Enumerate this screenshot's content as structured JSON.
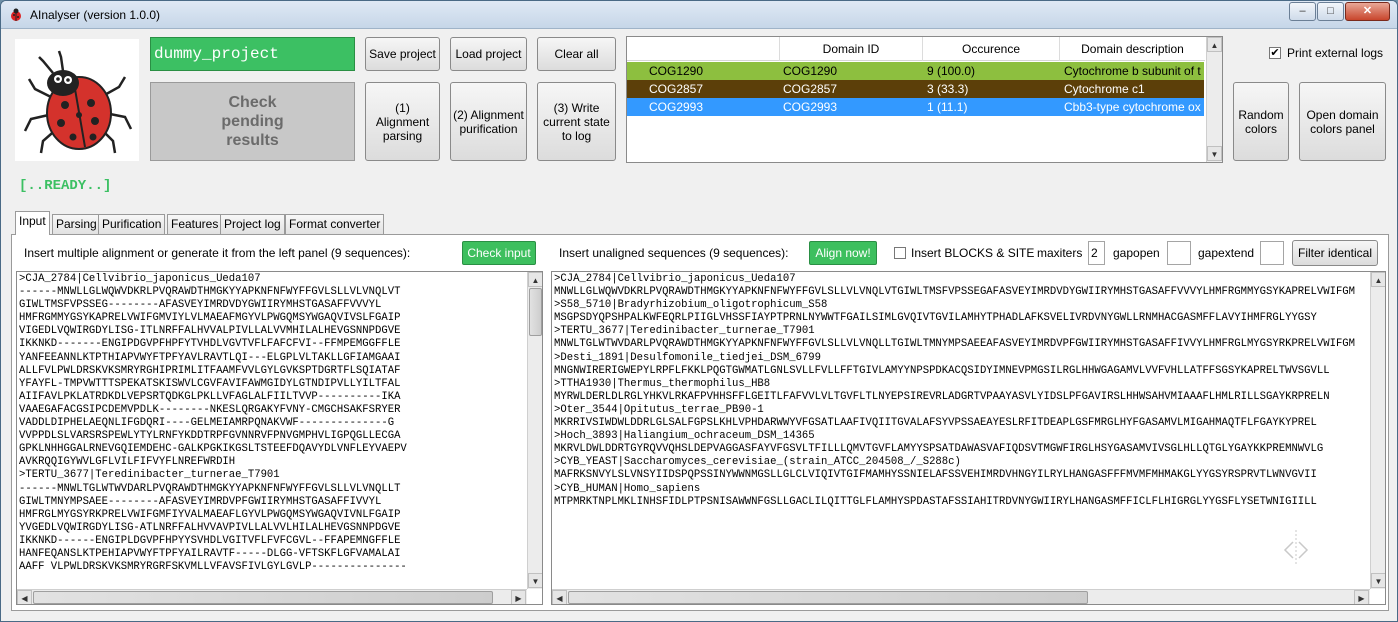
{
  "window": {
    "title": "AInalyser (version 1.0.0)",
    "min_glyph": "–",
    "max_glyph": "□",
    "close_glyph": "✕"
  },
  "project": {
    "name": "dummy_project",
    "check_label": "Check pending results",
    "status": "[..READY..]"
  },
  "toolbar": {
    "save": "Save project",
    "load": "Load project",
    "clear": "Clear all",
    "step1": "(1) Alignment parsing",
    "step2": "(2) Alignment purification",
    "step3": "(3) Write current state to log"
  },
  "domains": {
    "headers": [
      "",
      "Domain ID",
      "Occurence",
      "Domain description"
    ],
    "rows": [
      {
        "name": "COG1290",
        "id": "COG1290",
        "occ": "9 (100.0)",
        "desc": "Cytochrome b subunit of t",
        "bg": "#8dbf3f",
        "fg": "#000000"
      },
      {
        "name": "COG2857",
        "id": "COG2857",
        "occ": "3 (33.3)",
        "desc": "Cytochrome c1",
        "bg": "#5c3f09",
        "fg": "#ffffff"
      },
      {
        "name": "COG2993",
        "id": "COG2993",
        "occ": "1 (11.1)",
        "desc": "Cbb3-type cytochrome ox",
        "bg": "#3399ff",
        "fg": "#ffffff"
      }
    ]
  },
  "right": {
    "print_logs": "Print external logs",
    "print_logs_checked": true,
    "random_colors": "Random colors",
    "open_panel": "Open domain colors panel"
  },
  "tabs": [
    "Input",
    "Parsing",
    "Purification",
    "Features",
    "Project log",
    "Format converter"
  ],
  "left_pane": {
    "prompt": "Insert multiple alignment or generate it from the left panel (9 sequences):",
    "check_input": "Check input",
    "text": ">CJA_2784|Cellvibrio_japonicus_Ueda107\n------MNWLLGLWQWVDKRLPVQRAWDTHMGKYYAPKNFNFWYFFGVLSLLVLVNQLVT\nGIWLTMSFVPSSEG--------AFASVEYIMRDVDYGWIIRYMHSTGASAFFVVVYL\nHMFRGMMYGSYKAPRELVWIFGMVIYLVLMAEAFMGYVLPWGQMSYWGAQVIVSLFGAIP\nVIGEDLVQWIRGDYLISG-ITLNRFFALHVVALPIVLLALVVMHILALHEVGSNNPDGVE\nIKKNKD-------ENGIPDGVPFHPFYTVHDLVGVTVFLFAFCFVI--FFMPEMGGFFLE\nYANFEEANNLKTPTHIAPVWYFTPFYAVLRAVTLQI---ELGPLVLTAKLLGFIAMGAAI\nALLFVLPWLDRSKVKSMRYRGHIPRIMLITFAAMFVVLGYLGVKSPTDGRTFLSQIATAF\nYFAYFL-TMPVWTTTSPEKATSKISWVLCGVFAVIFAWMGIDYLGTNDIPVLLYILTFAL\nAIIFAVLPKLATRDKDLVEPSRTQDKGLPKLLVFAGLALFIILTVVP----------IKA\nVAAEGAFACGSIPCDEMVPDLK--------NKESLQRGAKYFVNY-CMGCHSAKFSRYER\nVADDLDIPHELAEQNLIFGDQRI----GELMEIAMRPQNAKVWF--------------G\nVVPPDLSLVARSRSPEWLYTYLRNFYKDDTRPFGVNNRVFPNVGMPHVLIGPQGLLECGA\nGPKLNHHGGALRNEVGQIEMDEHC-GALKPGKIKGSLTSTEEFDQAVYDLVNFLEYVAEPV\nAVKRQQIGYWVLGFLVILFIFVYFLNREFWRDIH\n>TERTU_3677|Teredinibacter_turnerae_T7901\n------MNWLTGLWTWVDARLPVQRAWDTHMGKYYAPKNFNFWYFFGVLSLLVLVNQLLT\nGIWLTMNYMPSAEE--------AFASVEYIMRDVPFGWIIRYMHSTGASAFFIVVYL\nHMFRGLMYGSYRKPRELVWIFGMFIYVALMAEAFLGYVLPWGQMSYWGAQVIVNLFGAIP\nYVGEDLVQWIRGDYLISG-ATLNRFFALHVVAVPIVLLALVVLHILALHEVGSNNPDGVE\nIKKNKD------ENGIPLDGVPFHPYYSVHDLVGITVFLFVFCGVL--FFAPEMNGFFLE\nHANFEQANSLKTPEHIAPVWYFTPFYAILRAVTF-----DLGG-VFTSKFLGFVAMALAI\nAAFF VLPWLDRSKVKSMRYRGRFSKVMLLVFAVSFIVLGYLGVLP---------------"
  },
  "right_pane": {
    "prompt": "Insert unaligned sequences (9 sequences):",
    "align_now": "Align now!",
    "blocks_label": "Insert BLOCKS & SITE",
    "blocks_checked": false,
    "maxiters_label": "maxiters",
    "maxiters_value": "2",
    "gapopen_label": "gapopen",
    "gapopen_value": "",
    "gapextend_label": "gapextend",
    "gapextend_value": "",
    "filter": "Filter identical",
    "text": ">CJA_2784|Cellvibrio_japonicus_Ueda107\nMNWLLGLWQWVDKRLPVQRAWDTHMGKYYAPKNFNFWYFFGVLSLLVLVNQLVTGIWLTMSFVPSSEGAFASVEYIMRDVDYGWIIRYMHSTGASAFFVVVYLHMFRGMMYGSYKAPRELVWIFGM\n>S58_5710|Bradyrhizobium_oligotrophicum_S58\nMSGPSDYQPSHPALKWFEQRLPIIGLVHSSFIAYPTPRNLNYWWTFGAILSIMLGVQIVTGVILAMHYTPHADLAFKSVELIVRDVNYGWLLRNMHACGASMFFLAVYIHMFRGLYYGSY\n>TERTU_3677|Teredinibacter_turnerae_T7901\nMNWLTGLWTWVDARLPVQRAWDTHMGKYYAPKNFNFWYFFGVLSLLVLVNQLLTGIWLTMNYMPSAEEAFASVEYIMRDVPFGWIIRYMHSTGASAFFIVVYLHMFRGLMYGSYRKPRELVWIFGM\n>Desti_1891|Desulfomonile_tiedjei_DSM_6799\nMNGNWIRERIGWEPYLRPFLFKKLPQGTGWMATLGNLSVLLFVLLFFTGIVLAMYYNPSPDKACQSIDYIMNEVPMGSILRGLHHWGAGAMVLVVFVHLLATFFSGSYKAPRELTWVSGVLL\n>TTHA1930|Thermus_thermophilus_HB8\nMYRWLDERLDLRGLYHKVLRKAFPVHHSFFLGEITLFAFVVLVLTGVFLTLNYEPSIREVRLADGRTVPAAYASVLYIDSLPFGAVIRSLHHWSAHVMIAAAFLHMLRILLSGAYKRPRELN\n>Oter_3544|Opitutus_terrae_PB90-1\nMKRRIVSIWDWLDDRLGLSALFGPSLKHLVPHDARWWYVFGSATLAAFIVQIITGVALAFSYVPSSAEAYESLRFITDEAPLGSFMRGLHYFGASAMVLMIGAHMAQTFLFGAYKYPREL\n>Hoch_3893|Haliangium_ochraceum_DSM_14365\nMKRVLDWLDDRTGYRQVVQHSLDEPVAGGASFAYVFGSVLTFILLLQMVTGVFLAMYYSPSATDAWASVAFIQDSVTMGWFIRGLHSYGASAMVIVSGLHLLQTGLYGAYKKPREMNWVLG\n>CYB_YEAST|Saccharomyces_cerevisiae_(strain_ATCC_204508_/_S288c)\nMAFRKSNVYLSLVNSYIIDSPQPSSINYWWNMGSLLGLCLVIQIVTGIFMAMHYSSNIELAFSSVEHIMRDVHNGYILRYLHANGASFFFMVMFMHMAKGLYYGSYRSPRVTLWNVGVII\n>CYB_HUMAN|Homo_sapiens\nMTPMRKTNPLMKLINHSFIDLPTPSNISAWWNFGSLLGACLILQITTGLFLAMHYSPDASTAFSSIAHITRDVNYGWIIRYLHANGASMFFICLFLHIGRGLYYGSFLYSETWNIGIILL"
  }
}
